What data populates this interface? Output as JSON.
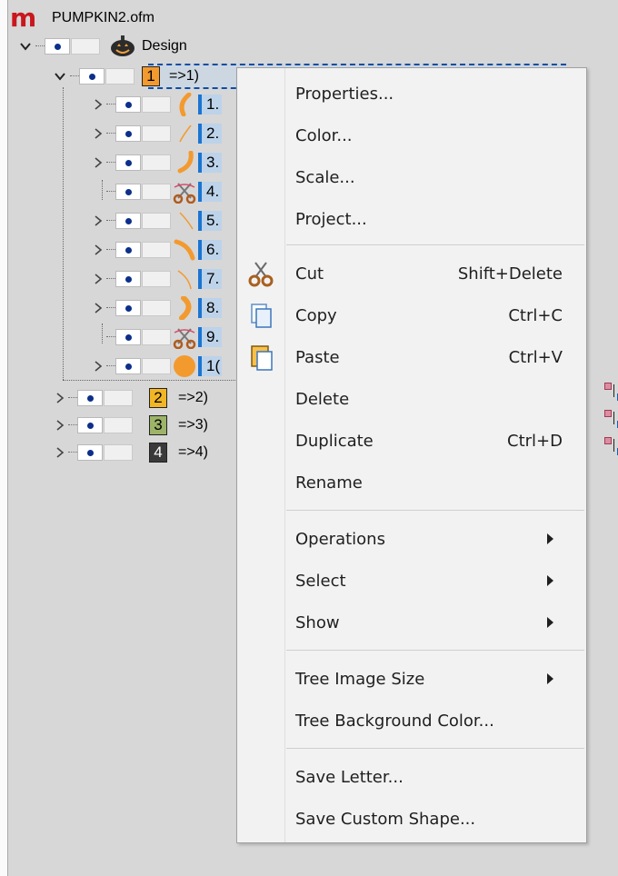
{
  "app": {
    "file_title": "PUMPKIN2.ofm",
    "logo_text": "m",
    "logo_color": "#c9171e"
  },
  "tree": {
    "root": {
      "label": "Design"
    },
    "groups": [
      {
        "number": "1",
        "label": "=>1)",
        "color": "#f39a2f",
        "selected": true
      },
      {
        "number": "2",
        "label": "=>2)",
        "color": "#f1b625"
      },
      {
        "number": "3",
        "label": "=>3)",
        "color": "#9db368"
      },
      {
        "number": "4",
        "label": "=>4)",
        "color": "#3a3a3a"
      }
    ],
    "children": [
      {
        "label": "1.",
        "shape": "arc",
        "expandable": true
      },
      {
        "label": "2.",
        "shape": "stroke",
        "expandable": true
      },
      {
        "label": "3.",
        "shape": "arc",
        "expandable": true
      },
      {
        "label": "4.",
        "shape": "scissors",
        "expandable": false
      },
      {
        "label": "5.",
        "shape": "stroke",
        "expandable": true
      },
      {
        "label": "6.",
        "shape": "arc",
        "expandable": true
      },
      {
        "label": "7.",
        "shape": "stroke",
        "expandable": true
      },
      {
        "label": "8.",
        "shape": "arc",
        "expandable": true
      },
      {
        "label": "9.",
        "shape": "scissors",
        "expandable": false
      },
      {
        "label": "1(",
        "shape": "dot",
        "expandable": true
      }
    ]
  },
  "context_menu": {
    "items": [
      {
        "label": "Properties...",
        "shortcut": ""
      },
      {
        "label": "Color...",
        "shortcut": ""
      },
      {
        "label": "Scale...",
        "shortcut": ""
      },
      {
        "label": "Project...",
        "shortcut": ""
      },
      {
        "label": "Cut",
        "shortcut": "Shift+Delete",
        "icon": "scissors-icon"
      },
      {
        "label": "Copy",
        "shortcut": "Ctrl+C",
        "icon": "copy-icon"
      },
      {
        "label": "Paste",
        "shortcut": "Ctrl+V",
        "icon": "paste-icon"
      },
      {
        "label": "Delete",
        "shortcut": ""
      },
      {
        "label": "Duplicate",
        "shortcut": "Ctrl+D"
      },
      {
        "label": "Rename",
        "shortcut": ""
      },
      {
        "label": "Operations",
        "submenu": true
      },
      {
        "label": "Select",
        "submenu": true
      },
      {
        "label": "Show",
        "submenu": true
      },
      {
        "label": "Tree Image Size",
        "submenu": true
      },
      {
        "label": "Tree Background Color...",
        "shortcut": ""
      },
      {
        "label": "Save Letter...",
        "shortcut": ""
      },
      {
        "label": "Save Custom Shape...",
        "shortcut": ""
      }
    ]
  }
}
